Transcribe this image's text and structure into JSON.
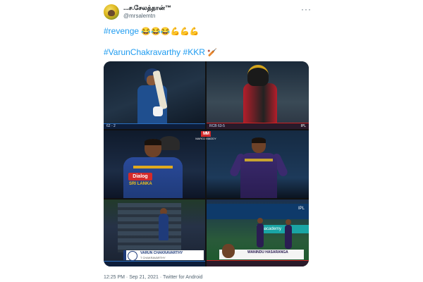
{
  "author": {
    "name": "...ச.சேலத்தான்™",
    "handle": "@mrsalemtn"
  },
  "menu_label": "···",
  "tweet": {
    "line1_tag": "#revenge",
    "line1_emoji": "😂😂😂💪💪💪",
    "line2_tag1": "#VarunChakravarthy",
    "line2_tag2": "#KKR",
    "line2_emoji": "🏏"
  },
  "media": {
    "watermark_logo": "MM",
    "watermark_text": "MAROJ MADDY",
    "ipl_badge": "IPL",
    "scorebar_left": "62 - 2",
    "scorebar_rcb": "RCB 63-5",
    "dialog_sponsor": "Dialog",
    "jersey_text": "SRI LANKA",
    "lower_third_name": "VARUN CHAKRAVARTHY",
    "lower_third_sub": "T CHAKRAVARTHY",
    "board_text": "IPL",
    "ad_text": "unacademy",
    "lower_third_b_name": "WANINDU HASARANGA"
  },
  "footer": {
    "time": "12:25 PM",
    "sep": "·",
    "date": "Sep 21, 2021",
    "source": "Twitter for Android"
  }
}
